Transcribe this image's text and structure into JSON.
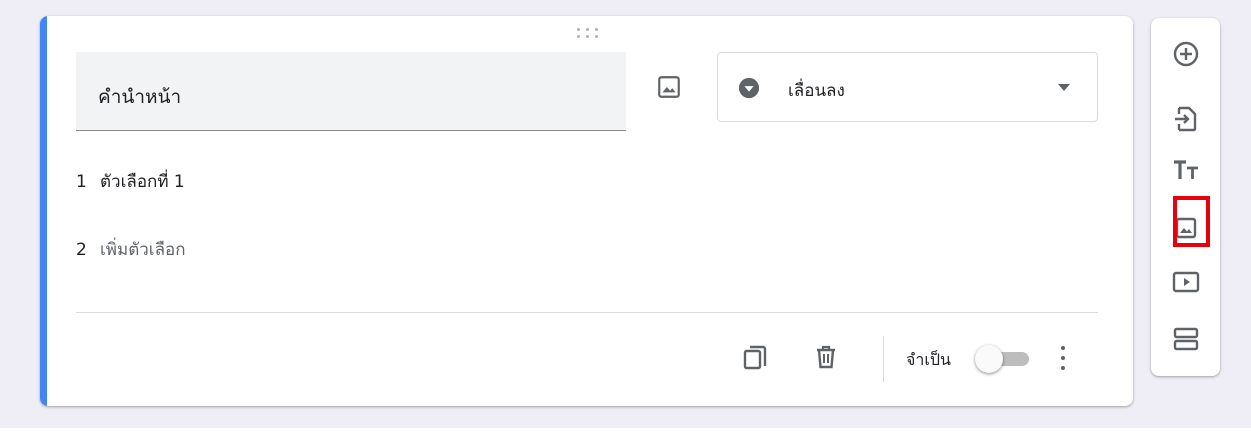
{
  "question": {
    "title": "คำนำหน้า",
    "type_label": "เลื่อนลง"
  },
  "options": [
    {
      "number": "1",
      "label": "ตัวเลือกที่ 1"
    },
    {
      "number": "2",
      "label": "เพิ่มตัวเลือก"
    }
  ],
  "footer": {
    "required_label": "จำเป็น",
    "required_on": false
  },
  "side_toolbar": {
    "tools": [
      "add-question",
      "import-questions",
      "add-title",
      "add-image",
      "add-video",
      "add-section"
    ],
    "highlighted_tool": "add-image"
  },
  "colors": {
    "accent": "#4285f4",
    "highlight": "#e8000d",
    "background": "#efedf5"
  }
}
